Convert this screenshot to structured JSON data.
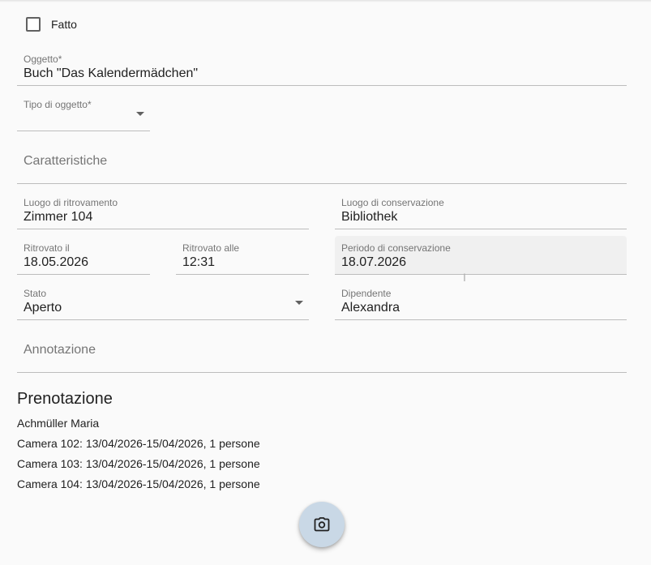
{
  "form": {
    "done_checkbox": {
      "label": "Fatto",
      "checked": false
    },
    "object": {
      "label": "Oggetto*",
      "value": "Buch \"Das Kalendermädchen\""
    },
    "object_type": {
      "label": "Tipo di oggetto*",
      "value": ""
    },
    "features": {
      "placeholder": "Caratteristiche"
    },
    "found_location": {
      "label": "Luogo di ritrovamento",
      "value": "Zimmer 104"
    },
    "storage_location": {
      "label": "Luogo di conservazione",
      "value": "Bibliothek"
    },
    "found_date": {
      "label": "Ritrovato il",
      "value": "18.05.2026"
    },
    "found_time": {
      "label": "Ritrovato alle",
      "value": "12:31"
    },
    "storage_period": {
      "label": "Periodo di conservazione",
      "value": "18.07.2026"
    },
    "status": {
      "label": "Stato",
      "value": "Aperto"
    },
    "employee": {
      "label": "Dipendente",
      "value": "Alexandra"
    },
    "note": {
      "placeholder": "Annotazione"
    }
  },
  "booking": {
    "title": "Prenotazione",
    "guest": "Achmüller Maria",
    "rooms": [
      "Camera 102: 13/04/2026-15/04/2026, 1 persone",
      "Camera 103: 13/04/2026-15/04/2026, 1 persone",
      "Camera 104: 13/04/2026-15/04/2026, 1 persone"
    ]
  },
  "fab": {
    "icon": "camera-icon"
  },
  "colors": {
    "fab_bg": "#c9d8e6",
    "underline": "#bdbdbd",
    "label": "#757575"
  }
}
